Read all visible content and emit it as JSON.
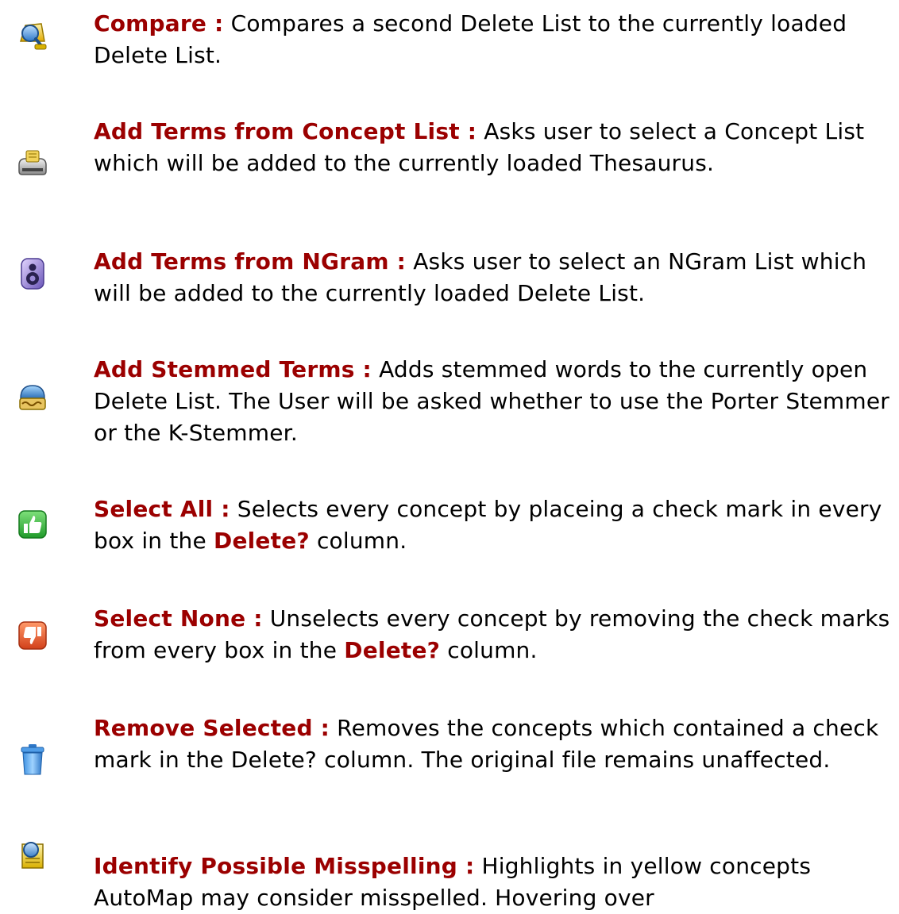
{
  "entries": [
    {
      "icon": "compare-icon",
      "term": "Compare :",
      "desc": "Compares a second Delete List to the currently loaded Delete List."
    },
    {
      "icon": "concept-list-icon",
      "term": "Add Terms from Concept List :",
      "desc": "Asks user to select a Concept List which will be added to the currently loaded Thesaurus."
    },
    {
      "icon": "ngram-icon",
      "term": "Add Terms from NGram :",
      "desc": "Asks user to select an NGram List which will be added to the currently loaded Delete List."
    },
    {
      "icon": "stemmed-terms-icon",
      "term": "Add Stemmed Terms :",
      "desc": "Adds stemmed words to the currently open Delete List. The User will be asked whether to use the Porter Stemmer or the K-Stemmer."
    },
    {
      "icon": "thumbs-up-icon",
      "term": "Select All :",
      "desc_before": "Selects every concept by placeing a check mark in every box in the",
      "desc_bold": "Delete?",
      "desc_after": "column."
    },
    {
      "icon": "thumbs-down-icon",
      "term": "Select None :",
      "desc_before": "Unselects every concept by removing the check marks from every box in the",
      "desc_bold": "Delete?",
      "desc_after": "column."
    },
    {
      "icon": "trash-icon",
      "term": "Remove Selected :",
      "desc": "Removes the concepts which contained a check mark in the Delete? column. The original file remains unaffected."
    },
    {
      "icon": "spell-check-icon",
      "term": "Identify Possible Misspelling :",
      "desc": "Highlights in yellow concepts AutoMap may consider misspelled. Hovering over"
    }
  ]
}
